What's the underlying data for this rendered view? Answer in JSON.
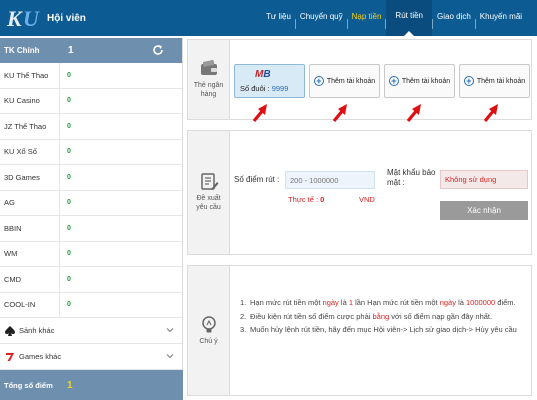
{
  "header": {
    "brand": "Hội viên",
    "nav": [
      {
        "label": "Tư liệu"
      },
      {
        "label": "Chuyển quỹ"
      },
      {
        "label": "Nạp tiền"
      },
      {
        "label": "Rút tiền"
      },
      {
        "label": "Giao dịch"
      },
      {
        "label": "Khuyến mãi"
      }
    ]
  },
  "sidebar": {
    "main": {
      "label": "TK Chính",
      "value": "1"
    },
    "accounts": [
      {
        "label": "KU Thể Thao",
        "value": "0"
      },
      {
        "label": "KU Casino",
        "value": "0"
      },
      {
        "label": "JZ Thể Thao",
        "value": "0"
      },
      {
        "label": "KU Xổ Số",
        "value": "0"
      },
      {
        "label": "3D Games",
        "value": "0"
      },
      {
        "label": "AG",
        "value": "0"
      },
      {
        "label": "BBIN",
        "value": "0"
      },
      {
        "label": "WM",
        "value": "0"
      },
      {
        "label": "CMD",
        "value": "0"
      },
      {
        "label": "COOL-IN",
        "value": "0"
      }
    ],
    "groups": [
      {
        "label": "Sảnh khác"
      },
      {
        "label": "Games khác"
      }
    ],
    "total": {
      "label": "Tổng số điểm",
      "value": "1"
    }
  },
  "bank_panel": {
    "title": "Thẻ ngân hàng",
    "selected_card": {
      "bank": "MB",
      "suffix_label": "Số đuôi : ",
      "suffix": "9999"
    },
    "add_labels": [
      "Thêm tài khoản",
      "Thêm tài khoản",
      "Thêm tài khoản"
    ]
  },
  "withdraw_panel": {
    "title": "Đề xuất yêu cầu",
    "amount_label": "Số điểm rút :",
    "amount_placeholder": "200 - 1000000",
    "actual_label": "Thực tế : ",
    "actual_value": "0",
    "currency": "VND",
    "pwd_label": "Mật khẩu bảo mật :",
    "pwd_value": "Không sử dụng",
    "submit": "Xác nhận"
  },
  "notes_panel": {
    "title": "Chú ý",
    "items": [
      {
        "num": "1.",
        "parts": [
          "Hạn mức rút tiền một ",
          "ngày",
          " là ",
          "1",
          " lần Hạn mức rút tiền một ",
          "ngày",
          " là ",
          "1000000",
          " điểm."
        ]
      },
      {
        "num": "2.",
        "parts": [
          "Điều kiện rút tiền số điểm cược phải ",
          "bằng",
          " với số điểm nạp gần đây nhất."
        ]
      },
      {
        "num": "3.",
        "parts": [
          "Muốn hủy lệnh rút tiền, hãy đến mục Hội viên-> Lịch sử giao dịch-> Hủy yêu cầu"
        ]
      }
    ]
  },
  "colors": {
    "header": "#0d5b93",
    "sidebar_head": "#6e90ae",
    "highlight": "#f5d31a",
    "value_green": "#1f9b3b",
    "alert_red": "#d22222"
  }
}
